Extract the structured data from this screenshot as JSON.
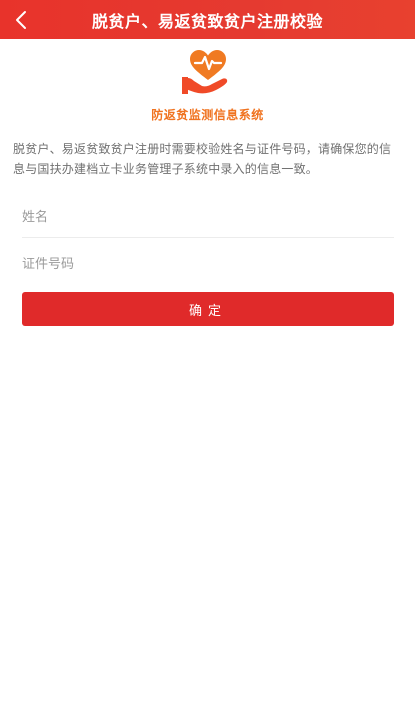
{
  "header": {
    "title": "脱贫户、易返贫致贫户注册校验",
    "back_icon": "chevron-left-icon"
  },
  "logo": {
    "icon": "heart-hand-icon",
    "colors": {
      "heart": "#f07a22",
      "hand": "#f04a28"
    }
  },
  "system_name": "防返贫监测信息系统",
  "description": "脱贫户、易返贫致贫户注册时需要校验姓名与证件号码，请确保您的信息与国扶办建档立卡业务管理子系统中录入的信息一致。",
  "form": {
    "name_placeholder": "姓名",
    "name_value": "",
    "id_placeholder": "证件号码",
    "id_value": ""
  },
  "confirm_label": "确定",
  "colors": {
    "header_bg": "#e8332b",
    "button_bg": "#e02a2a",
    "accent_orange": "#f07320"
  }
}
